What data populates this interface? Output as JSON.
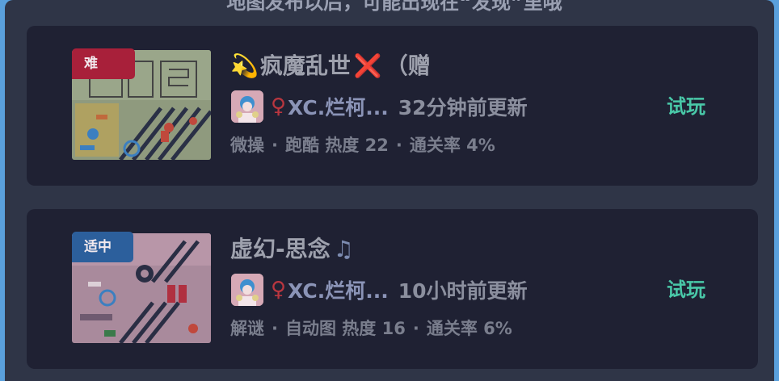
{
  "hint": "地图发布以后，可能出现在“发现”里哦",
  "levels": [
    {
      "difficulty": "难",
      "title_emoji": "💫",
      "title": "疯魔乱世",
      "title_x": "❌",
      "title_note": "（赠",
      "gender": "♀",
      "author": "XC.烂柯...",
      "updated": "32分钟前更新",
      "tags": [
        "微操",
        "跑酷"
      ],
      "heat_label": "热度",
      "heat": "22",
      "clear_label": "通关率",
      "clear_rate": "4%",
      "action": "试玩"
    },
    {
      "difficulty": "适中",
      "title_emoji": "",
      "title": "虚幻-思念",
      "title_x": "",
      "title_note": "♫",
      "gender": "♀",
      "author": "XC.烂柯...",
      "updated": "10小时前更新",
      "tags": [
        "解谜",
        "自动图"
      ],
      "heat_label": "热度",
      "heat": "16",
      "clear_label": "通关率",
      "clear_rate": "6%",
      "action": "试玩"
    }
  ],
  "colors": {
    "panel": "#2f3547",
    "card": "#1f2133",
    "try": "#49c8a8",
    "hard": "#a8203a",
    "medium": "#2c5f9c"
  }
}
